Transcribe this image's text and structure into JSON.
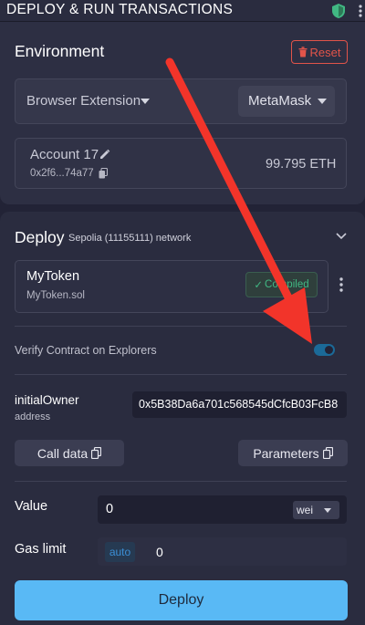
{
  "header": {
    "title": "DEPLOY & RUN TRANSACTIONS"
  },
  "environment": {
    "title": "Environment",
    "reset_label": "Reset",
    "provider": "Browser Extension",
    "wallet": "MetaMask",
    "account": {
      "name": "Account 17",
      "address": "0x2f6...74a77",
      "balance": "99.795 ETH"
    }
  },
  "deploy": {
    "title": "Deploy",
    "network": "Sepolia (11155111) network",
    "contract": {
      "name": "MyToken",
      "file": "MyToken.sol",
      "status": "Compiled"
    },
    "verify_label": "Verify Contract on Explorers",
    "verify_enabled": true,
    "param": {
      "name": "initialOwner",
      "type": "address",
      "value": "0x5B38Da6a701c568545dCfcB03FcB8"
    },
    "calldata_label": "Call data",
    "parameters_label": "Parameters",
    "value_label": "Value",
    "value": "0",
    "value_unit": "wei",
    "gas_label": "Gas limit",
    "gas_mode": "auto",
    "gas_value": "0",
    "deploy_label": "Deploy"
  },
  "colors": {
    "accent": "#59b9f5",
    "danger": "#e2544a",
    "success": "#41b883",
    "annotation_arrow": "#f2342a"
  }
}
